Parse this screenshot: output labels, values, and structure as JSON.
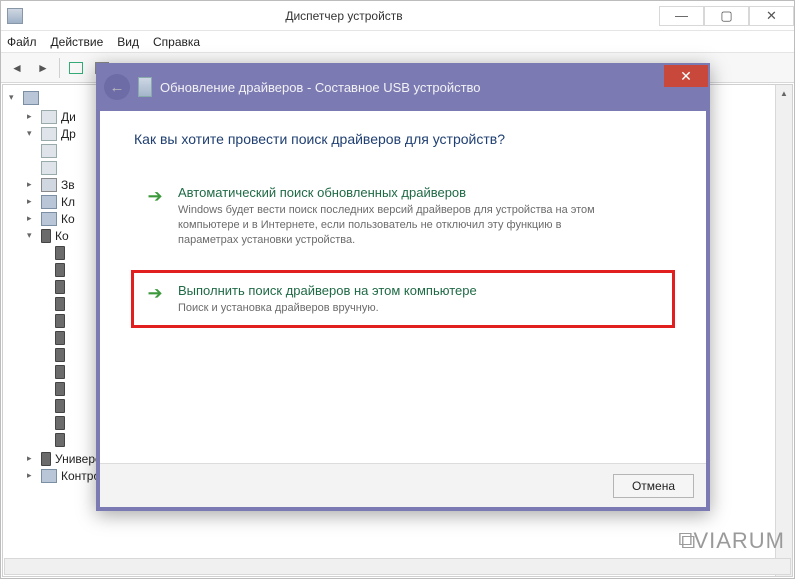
{
  "titlebar": {
    "title": "Диспетчер устройств"
  },
  "menu": {
    "file": "Файл",
    "action": "Действие",
    "view": "Вид",
    "help": "Справка"
  },
  "tree": {
    "items": [
      {
        "label": "Ди",
        "icon": "disk",
        "expander": "▸"
      },
      {
        "label": "Др",
        "icon": "disk",
        "expander": "▾"
      },
      {
        "label": "",
        "icon": "disk",
        "expander": ""
      },
      {
        "label": "",
        "icon": "disk",
        "expander": ""
      },
      {
        "label": "Зв",
        "icon": "sound",
        "expander": "▸"
      },
      {
        "label": "Кл",
        "icon": "node",
        "expander": "▸"
      },
      {
        "label": "Ко",
        "icon": "node",
        "expander": "▸"
      },
      {
        "label": "Ко",
        "icon": "usb",
        "expander": "▾"
      }
    ],
    "bottom": [
      "Универсальный USB-концентратор",
      "Контроллеры запоминающих устройств"
    ]
  },
  "wizard": {
    "title": "Обновление драйверов - Составное USB устройство",
    "heading": "Как вы хотите провести поиск драйверов для устройств?",
    "option1": {
      "title": "Автоматический поиск обновленных драйверов",
      "desc": "Windows будет вести поиск последних версий драйверов для устройства на этом компьютере и в Интернете, если пользователь не отключил эту функцию в параметрах установки устройства."
    },
    "option2": {
      "title": "Выполнить поиск драйверов на этом компьютере",
      "desc": "Поиск и установка драйверов вручную."
    },
    "cancel": "Отмена"
  },
  "watermark": "VIARUM"
}
